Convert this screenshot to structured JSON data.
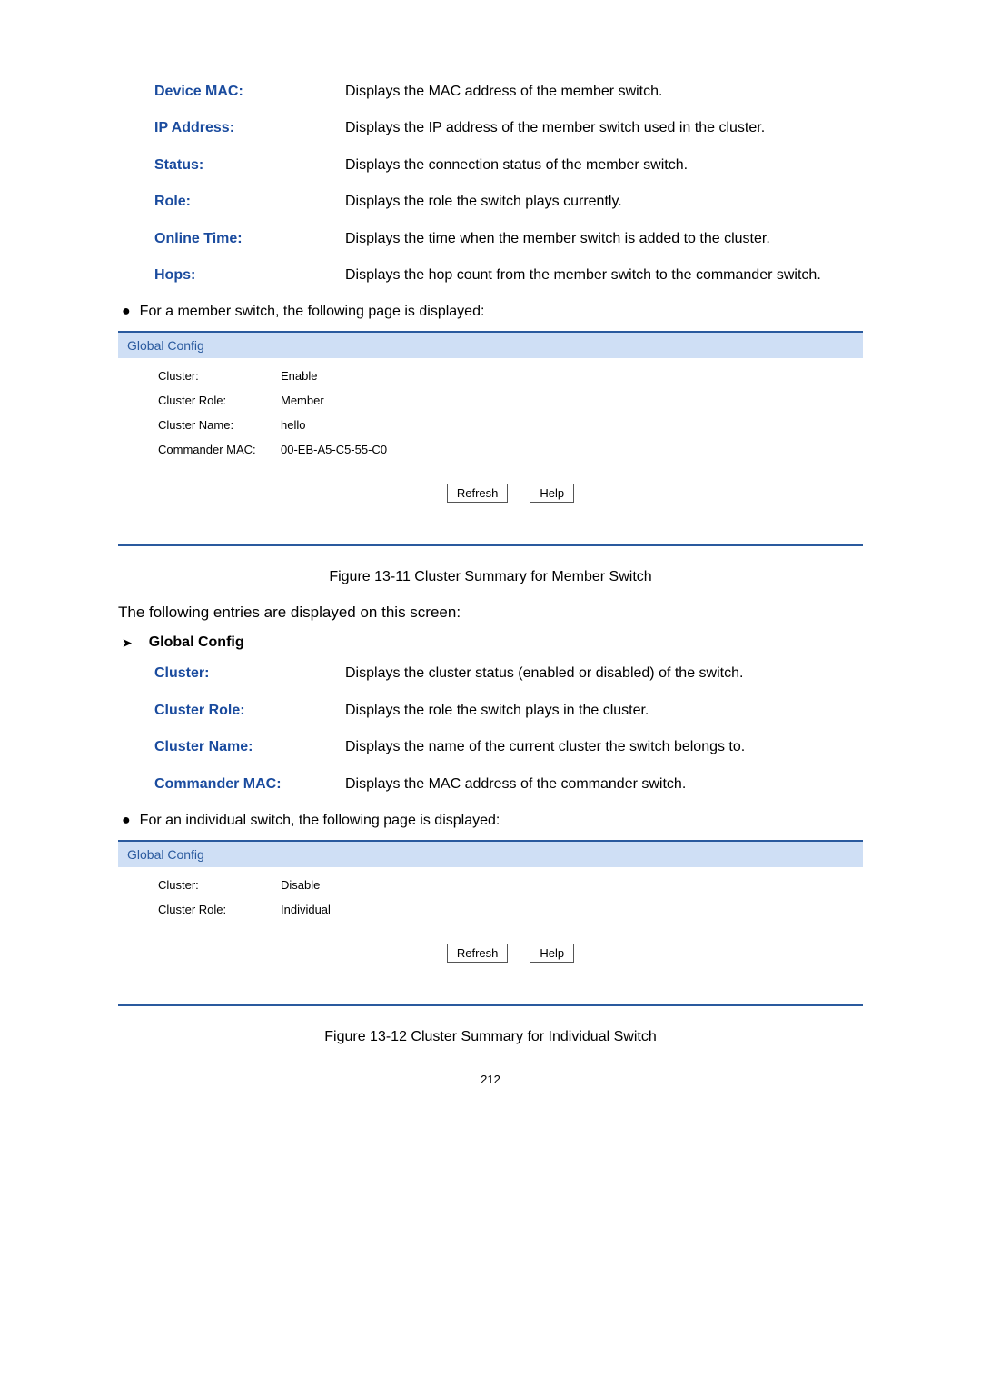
{
  "topDefs": [
    {
      "term": "Device MAC:",
      "desc": "Displays the MAC address of the member switch."
    },
    {
      "term": "IP Address:",
      "desc": "Displays the IP address of the member switch used in the cluster."
    },
    {
      "term": "Status:",
      "desc": "Displays the connection status of the member switch."
    },
    {
      "term": "Role:",
      "desc": "Displays the role the switch plays currently."
    },
    {
      "term": "Online Time:",
      "desc": "Displays the time when the member switch is added to the cluster."
    },
    {
      "term": "Hops:",
      "desc": "Displays the hop count from the member switch to the commander switch."
    }
  ],
  "bullet1": "For a member switch, the following page is displayed:",
  "panel1": {
    "header": "Global Config",
    "rows": [
      {
        "label": "Cluster:",
        "value": "Enable"
      },
      {
        "label": "Cluster Role:",
        "value": "Member"
      },
      {
        "label": "Cluster Name:",
        "value": "hello"
      },
      {
        "label": "Commander MAC:",
        "value": "00-EB-A5-C5-55-C0"
      }
    ],
    "refreshBtn": "Refresh",
    "helpBtn": "Help"
  },
  "figCaption1": "Figure 13-11 Cluster Summary for Member Switch",
  "intro": "The following entries are displayed on this screen:",
  "sectionTitle": "Global Config",
  "midDefs": [
    {
      "term": "Cluster:",
      "desc": "Displays the cluster status (enabled or disabled) of the switch."
    },
    {
      "term": "Cluster Role:",
      "desc": "Displays the role the switch plays in the cluster."
    },
    {
      "term": "Cluster Name:",
      "desc": "Displays the name of the current cluster the switch belongs to."
    },
    {
      "term": "Commander MAC:",
      "desc": "Displays the MAC address of the commander switch."
    }
  ],
  "bullet2": "For an individual switch, the following page is displayed:",
  "panel2": {
    "header": "Global Config",
    "rows": [
      {
        "label": "Cluster:",
        "value": "Disable"
      },
      {
        "label": "Cluster Role:",
        "value": "Individual"
      }
    ],
    "refreshBtn": "Refresh",
    "helpBtn": "Help"
  },
  "figCaption2": "Figure 13-12 Cluster Summary for Individual Switch",
  "pageNumber": "212"
}
